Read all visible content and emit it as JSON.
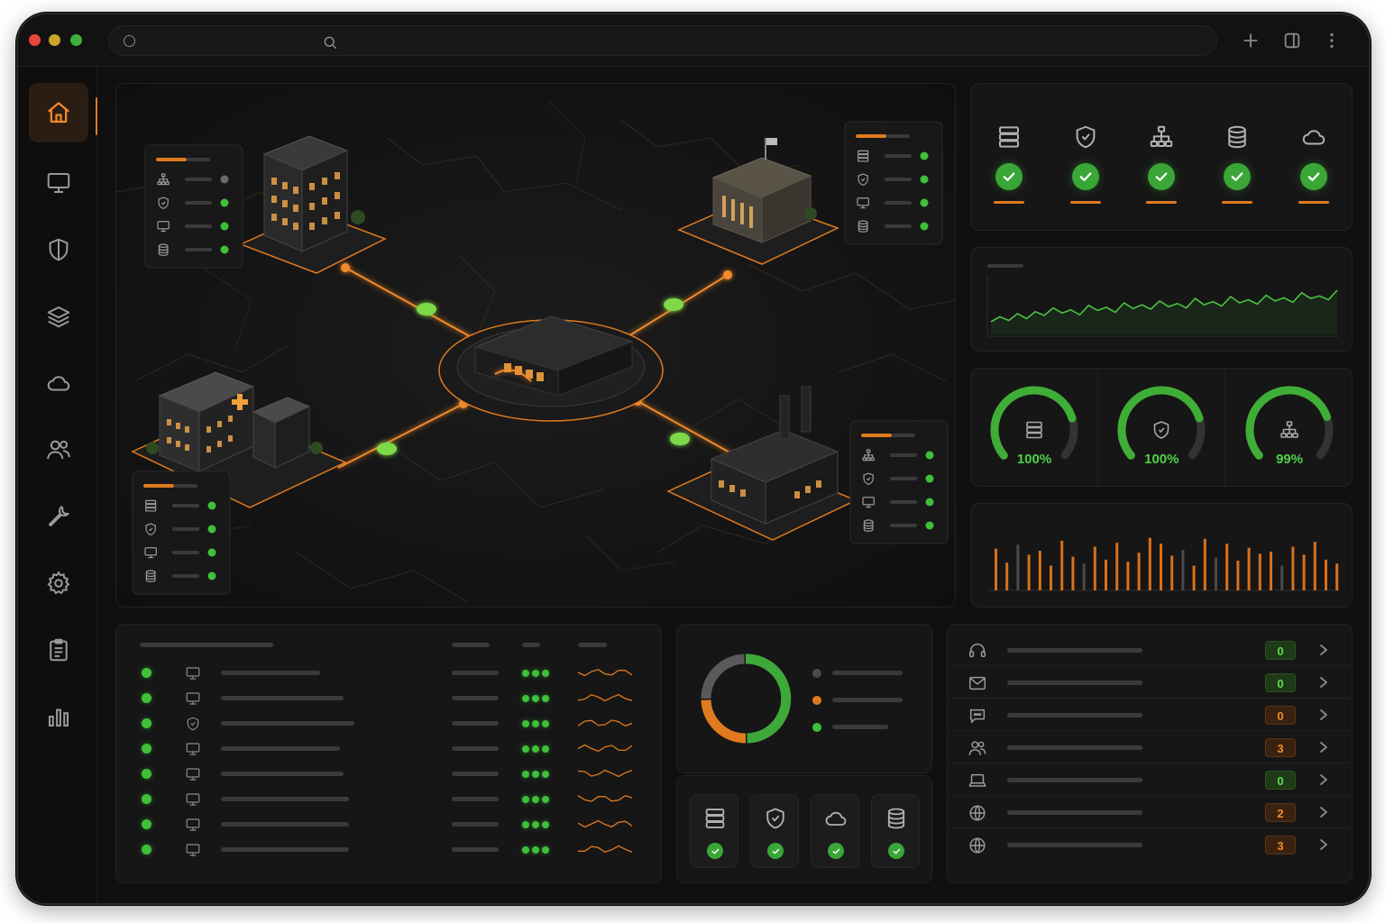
{
  "colors": {
    "accent_orange": "#e07a1f",
    "status_green": "#3fbf3a",
    "background": "#101010",
    "panel": "#161616"
  },
  "window": {
    "traffic_lights": [
      "close",
      "minimize",
      "zoom"
    ],
    "address_icons": [
      "page-icon",
      "search-icon"
    ],
    "toolbar_icons": [
      "plus-icon",
      "sidebar-toggle-icon",
      "more-vertical-icon"
    ]
  },
  "sidebar": {
    "items": [
      {
        "icon": "home-icon",
        "active": true
      },
      {
        "icon": "monitor-icon",
        "active": false
      },
      {
        "icon": "shield-icon",
        "active": false
      },
      {
        "icon": "layers-icon",
        "active": false
      },
      {
        "icon": "cloud-icon",
        "active": false
      },
      {
        "icon": "users-icon",
        "active": false
      },
      {
        "icon": "wrench-icon",
        "active": false
      },
      {
        "icon": "gear-icon",
        "active": false
      },
      {
        "icon": "clipboard-icon",
        "active": false
      },
      {
        "icon": "bar-chart-icon",
        "active": false
      }
    ]
  },
  "status_overview": {
    "items": [
      {
        "icon": "server-icon",
        "status": "ok"
      },
      {
        "icon": "shield-icon",
        "status": "ok"
      },
      {
        "icon": "network-icon",
        "status": "ok"
      },
      {
        "icon": "database-icon",
        "status": "ok"
      },
      {
        "icon": "cloud-icon",
        "status": "ok"
      }
    ]
  },
  "gauges": [
    {
      "icon": "server-icon",
      "value": 1.0,
      "label": "100%"
    },
    {
      "icon": "shield-icon",
      "value": 1.0,
      "label": "100%"
    },
    {
      "icon": "network-icon",
      "value": 0.99,
      "label": "99%"
    }
  ],
  "donut": {
    "segments": [
      {
        "color": "#3fa83a",
        "fraction": 0.5
      },
      {
        "color": "#e07a1f",
        "fraction": 0.25
      },
      {
        "color": "#5a5a5a",
        "fraction": 0.25
      }
    ],
    "legend_dots": [
      "#4a4a4a",
      "#e07a1f",
      "#3fbf3a"
    ]
  },
  "services": [
    {
      "icon": "server-icon",
      "status": "ok"
    },
    {
      "icon": "shield-icon",
      "status": "ok"
    },
    {
      "icon": "cloud-icon",
      "status": "ok"
    },
    {
      "icon": "database-icon",
      "status": "ok"
    }
  ],
  "device_rows": [
    {
      "icon": "monitor-icon",
      "status": "online"
    },
    {
      "icon": "monitor-icon",
      "status": "online"
    },
    {
      "icon": "shield-icon",
      "status": "online"
    },
    {
      "icon": "monitor-icon",
      "status": "online"
    },
    {
      "icon": "monitor-icon",
      "status": "online"
    },
    {
      "icon": "monitor-icon",
      "status": "online"
    },
    {
      "icon": "monitor-icon",
      "status": "online"
    },
    {
      "icon": "monitor-icon",
      "status": "online"
    }
  ],
  "contacts": [
    {
      "icon": "headset-icon",
      "count": "0",
      "tone": "g"
    },
    {
      "icon": "mail-icon",
      "count": "0",
      "tone": "g"
    },
    {
      "icon": "chat-icon",
      "count": "0",
      "tone": "o"
    },
    {
      "icon": "users-icon",
      "count": "3",
      "tone": "o"
    },
    {
      "icon": "laptop-icon",
      "count": "0",
      "tone": "g"
    },
    {
      "icon": "globe-icon",
      "count": "2",
      "tone": "o"
    },
    {
      "icon": "globe-icon",
      "count": "3",
      "tone": "o"
    }
  ],
  "activity_chart": {
    "values": [
      0.42,
      0.28,
      0.46,
      0.36,
      0.4,
      0.25,
      0.5,
      0.34,
      0.27,
      0.44,
      0.31,
      0.48,
      0.29,
      0.38,
      0.53,
      0.47,
      0.35,
      0.41,
      0.25,
      0.52,
      0.33,
      0.47,
      0.3,
      0.43,
      0.37,
      0.39,
      0.25,
      0.44,
      0.36,
      0.49,
      0.31,
      0.27
    ],
    "shades": [
      "o",
      "o",
      "g",
      "o",
      "o",
      "o",
      "o",
      "o",
      "g",
      "o",
      "o",
      "o",
      "o",
      "o",
      "o",
      "o",
      "o",
      "g",
      "o",
      "o",
      "g",
      "o",
      "o",
      "o",
      "o",
      "o",
      "g",
      "o",
      "o",
      "o",
      "o",
      "o"
    ]
  },
  "traffic_chart": {
    "values": [
      0.2,
      0.28,
      0.22,
      0.33,
      0.25,
      0.36,
      0.3,
      0.42,
      0.34,
      0.39,
      0.31,
      0.46,
      0.38,
      0.43,
      0.35,
      0.5,
      0.41,
      0.47,
      0.4,
      0.53,
      0.44,
      0.49,
      0.42,
      0.57,
      0.47,
      0.52,
      0.45,
      0.6,
      0.5,
      0.55,
      0.48,
      0.62,
      0.53,
      0.58,
      0.51,
      0.66,
      0.57,
      0.61,
      0.55,
      0.7
    ]
  },
  "sites": [
    {
      "name": "office-building",
      "indicators": [
        "#6a6a6a",
        "#3fbf3a",
        "#3fbf3a",
        "#3fbf3a"
      ]
    },
    {
      "name": "government-building",
      "indicators": [
        "#3fbf3a",
        "#3fbf3a",
        "#3fbf3a",
        "#3fbf3a"
      ]
    },
    {
      "name": "hospital-building",
      "indicators": [
        "#3fbf3a",
        "#3fbf3a",
        "#3fbf3a",
        "#3fbf3a"
      ]
    },
    {
      "name": "factory-building",
      "indicators": [
        "#3fbf3a",
        "#3fbf3a",
        "#3fbf3a",
        "#3fbf3a"
      ]
    }
  ]
}
